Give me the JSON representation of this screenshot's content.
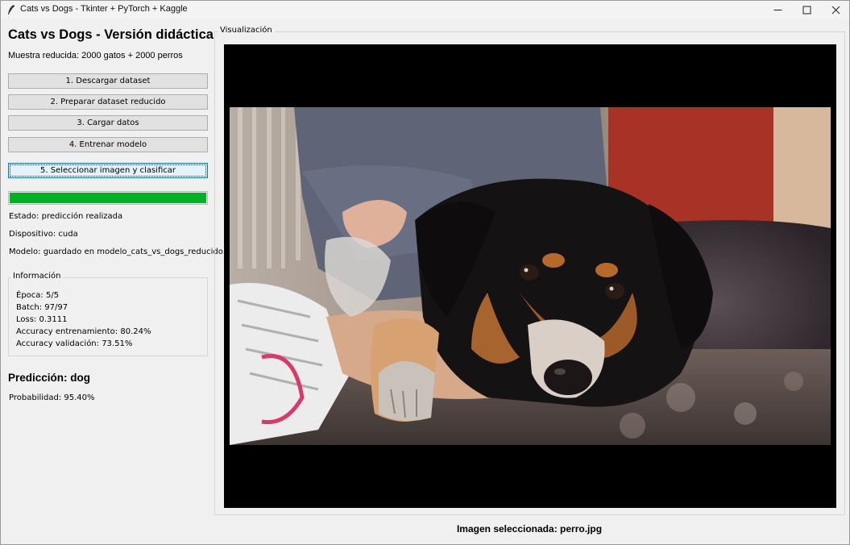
{
  "window": {
    "title": "Cats vs Dogs - Tkinter + PyTorch + Kaggle",
    "icon": "feather-icon"
  },
  "sidebar": {
    "heading": "Cats vs Dogs - Versión didáctica",
    "subtitle": "Muestra reducida: 2000 gatos + 2000 perros",
    "buttons": [
      {
        "label": "1. Descargar dataset"
      },
      {
        "label": "2. Preparar dataset reducido"
      },
      {
        "label": "3. Cargar datos"
      },
      {
        "label": "4. Entrenar modelo"
      },
      {
        "label": "5. Seleccionar imagen y clasificar"
      }
    ],
    "progress": 1.0,
    "progress_color": "#06b025",
    "status_lines": [
      "Estado: predicción realizada",
      "Dispositivo: cuda",
      "Modelo: guardado en modelo_cats_vs_dogs_reducido.pth"
    ]
  },
  "info": {
    "legend": "Información",
    "lines": [
      "Época: 5/5",
      "Batch: 97/97",
      "Loss: 0.3111",
      "Accuracy entrenamiento: 80.24%",
      "Accuracy validación: 73.51%"
    ]
  },
  "result": {
    "prediction": "Predicción: dog",
    "probability": "Probabilidad: 95.40%"
  },
  "visualization": {
    "legend": "Visualización",
    "image": "dog-photo",
    "selected_label": "Imagen seleccionada: perro.jpg"
  }
}
